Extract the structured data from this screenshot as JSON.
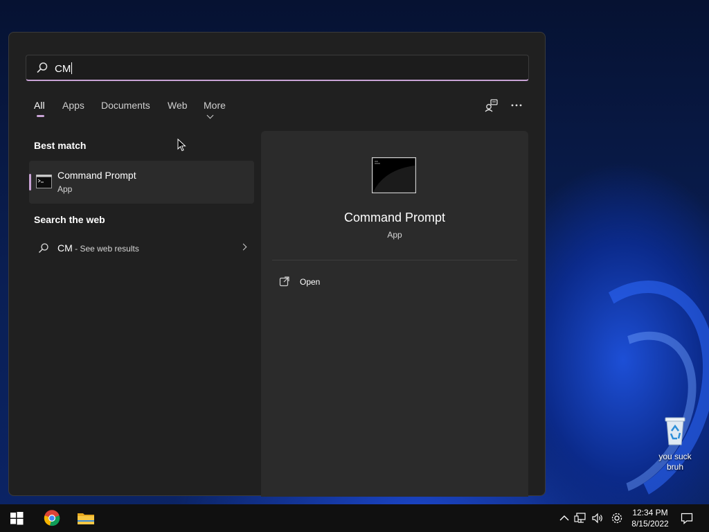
{
  "desktop": {
    "recycle_bin_label_line1": "you suck",
    "recycle_bin_label_line2": "bruh"
  },
  "search": {
    "query": "CM"
  },
  "tabs": [
    {
      "label": "All",
      "active": true
    },
    {
      "label": "Apps",
      "active": false
    },
    {
      "label": "Documents",
      "active": false
    },
    {
      "label": "Web",
      "active": false
    },
    {
      "label": "More",
      "active": false
    }
  ],
  "header_buttons": [
    "feedback-icon",
    "more-options-icon"
  ],
  "best_match": {
    "section_title": "Best match",
    "name": "Command Prompt",
    "type": "App",
    "icon": "command-prompt-icon"
  },
  "search_web": {
    "section_title": "Search the web",
    "query": "CM",
    "suffix": " - See web results"
  },
  "preview": {
    "name": "Command Prompt",
    "type": "App",
    "actions": [
      {
        "label": "Open",
        "icon": "open-external-icon"
      }
    ]
  },
  "taskbar": {
    "pinned": [
      "windows-start-icon",
      "chrome-icon",
      "file-explorer-icon"
    ],
    "tray": [
      "chevron-up-icon",
      "network-icon",
      "volume-icon",
      "settings-icon"
    ],
    "time": "12:34 PM",
    "date": "8/15/2022",
    "notification_icon": "notification-icon"
  },
  "colors": {
    "accent": "#c9a3d6",
    "panel": "#202020",
    "preview_panel": "#2b2b2b",
    "taskbar": "#101010"
  }
}
